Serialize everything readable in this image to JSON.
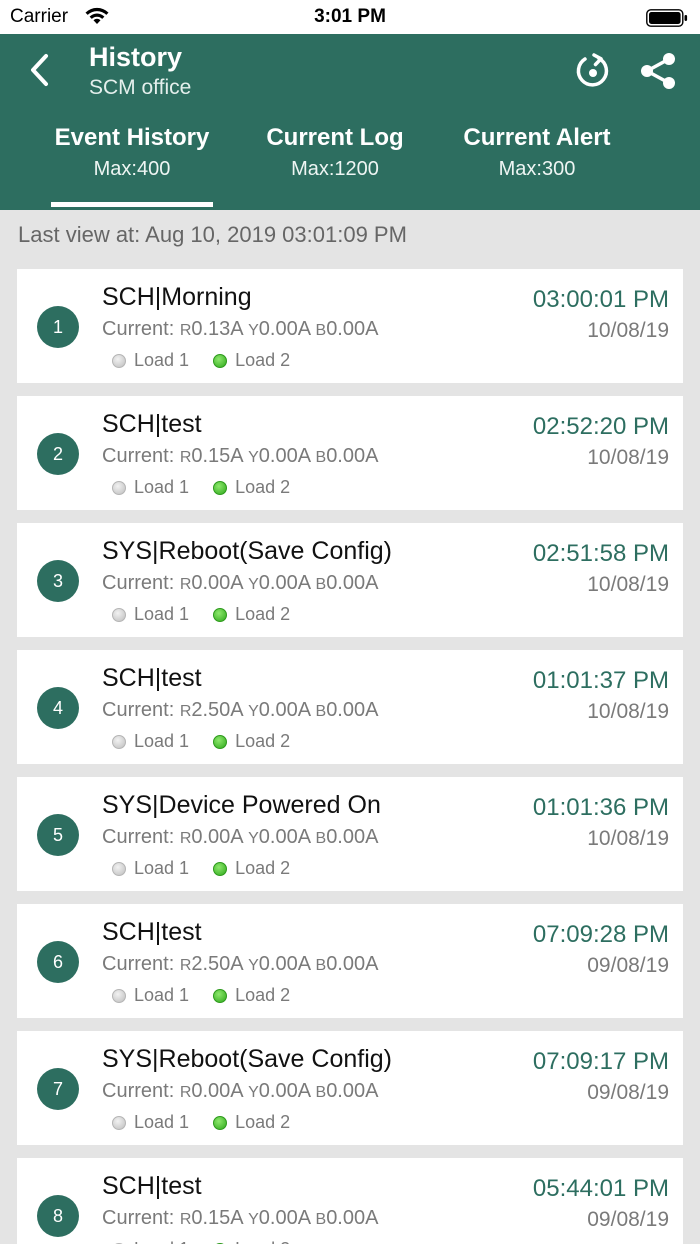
{
  "status_bar": {
    "carrier": "Carrier",
    "time": "3:01 PM"
  },
  "header": {
    "title": "History",
    "subtitle": "SCM office"
  },
  "tabs": [
    {
      "label": "Event History",
      "sub": "Max:400",
      "active": true
    },
    {
      "label": "Current Log",
      "sub": "Max:1200",
      "active": false
    },
    {
      "label": "Current Alert",
      "sub": "Max:300",
      "active": false
    }
  ],
  "last_view": "Last view at: Aug 10, 2019 03:01:09 PM",
  "current_label": "Current:",
  "phase_labels": {
    "r": "R",
    "y": "Y",
    "b": "B"
  },
  "load_labels": {
    "load1": "Load 1",
    "load2": "Load 2"
  },
  "colors": {
    "primary": "#2d6e60",
    "load_off": "#c4c4c4",
    "load_on": "#3cb52a"
  },
  "events": [
    {
      "num": "1",
      "title": "SCH|Morning",
      "r": "0.13A",
      "y": "0.00A",
      "b": "0.00A",
      "time": "03:00:01 PM",
      "date": "10/08/19",
      "load1_on": false,
      "load2_on": true
    },
    {
      "num": "2",
      "title": "SCH|test",
      "r": "0.15A",
      "y": "0.00A",
      "b": "0.00A",
      "time": "02:52:20 PM",
      "date": "10/08/19",
      "load1_on": false,
      "load2_on": true
    },
    {
      "num": "3",
      "title": "SYS|Reboot(Save Config)",
      "r": "0.00A",
      "y": "0.00A",
      "b": "0.00A",
      "time": "02:51:58 PM",
      "date": "10/08/19",
      "load1_on": false,
      "load2_on": true
    },
    {
      "num": "4",
      "title": "SCH|test",
      "r": "2.50A",
      "y": "0.00A",
      "b": "0.00A",
      "time": "01:01:37 PM",
      "date": "10/08/19",
      "load1_on": false,
      "load2_on": true
    },
    {
      "num": "5",
      "title": "SYS|Device Powered On",
      "r": "0.00A",
      "y": "0.00A",
      "b": "0.00A",
      "time": "01:01:36 PM",
      "date": "10/08/19",
      "load1_on": false,
      "load2_on": true
    },
    {
      "num": "6",
      "title": "SCH|test",
      "r": "2.50A",
      "y": "0.00A",
      "b": "0.00A",
      "time": "07:09:28 PM",
      "date": "09/08/19",
      "load1_on": false,
      "load2_on": true
    },
    {
      "num": "7",
      "title": "SYS|Reboot(Save Config)",
      "r": "0.00A",
      "y": "0.00A",
      "b": "0.00A",
      "time": "07:09:17 PM",
      "date": "09/08/19",
      "load1_on": false,
      "load2_on": true
    },
    {
      "num": "8",
      "title": "SCH|test",
      "r": "0.15A",
      "y": "0.00A",
      "b": "0.00A",
      "time": "05:44:01 PM",
      "date": "09/08/19",
      "load1_on": false,
      "load2_on": true
    }
  ]
}
